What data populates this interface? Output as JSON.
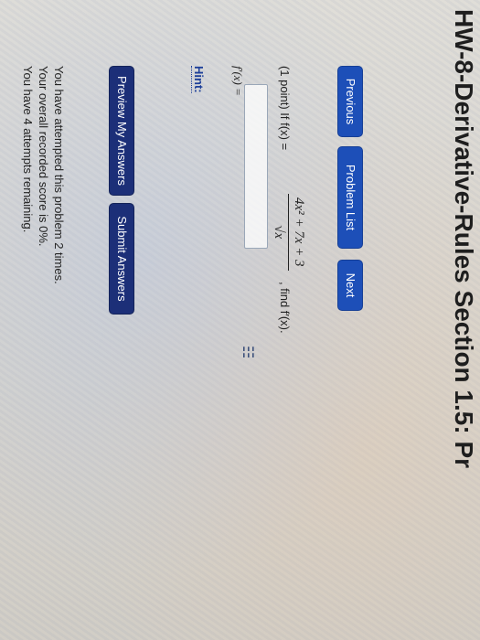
{
  "page": {
    "title": "HW-8-Derivative-Rules Section 1.5: Pr"
  },
  "nav": {
    "previous_label": "Previous",
    "problem_list_label": "Problem List",
    "next_label": "Next"
  },
  "problem": {
    "points": "(1 point) If f(x) =",
    "numerator": "4x² + 7x + 3",
    "denominator": "√x",
    "find": ", find f′(x)."
  },
  "answer": {
    "label": "f′(x) =",
    "value": "",
    "grid_icon": "grid-icon"
  },
  "hint": {
    "label": "Hint:"
  },
  "actions": {
    "preview_label": "Preview My Answers",
    "submit_label": "Submit Answers"
  },
  "status": {
    "attempted": "You have attempted this problem 2 times.",
    "score": "Your overall recorded score is 0%.",
    "remaining": "You have 4 attempts remaining."
  },
  "colors": {
    "primary_button": "#1d4fb8",
    "dark_button": "#1c2f78",
    "link": "#1d3f99"
  }
}
